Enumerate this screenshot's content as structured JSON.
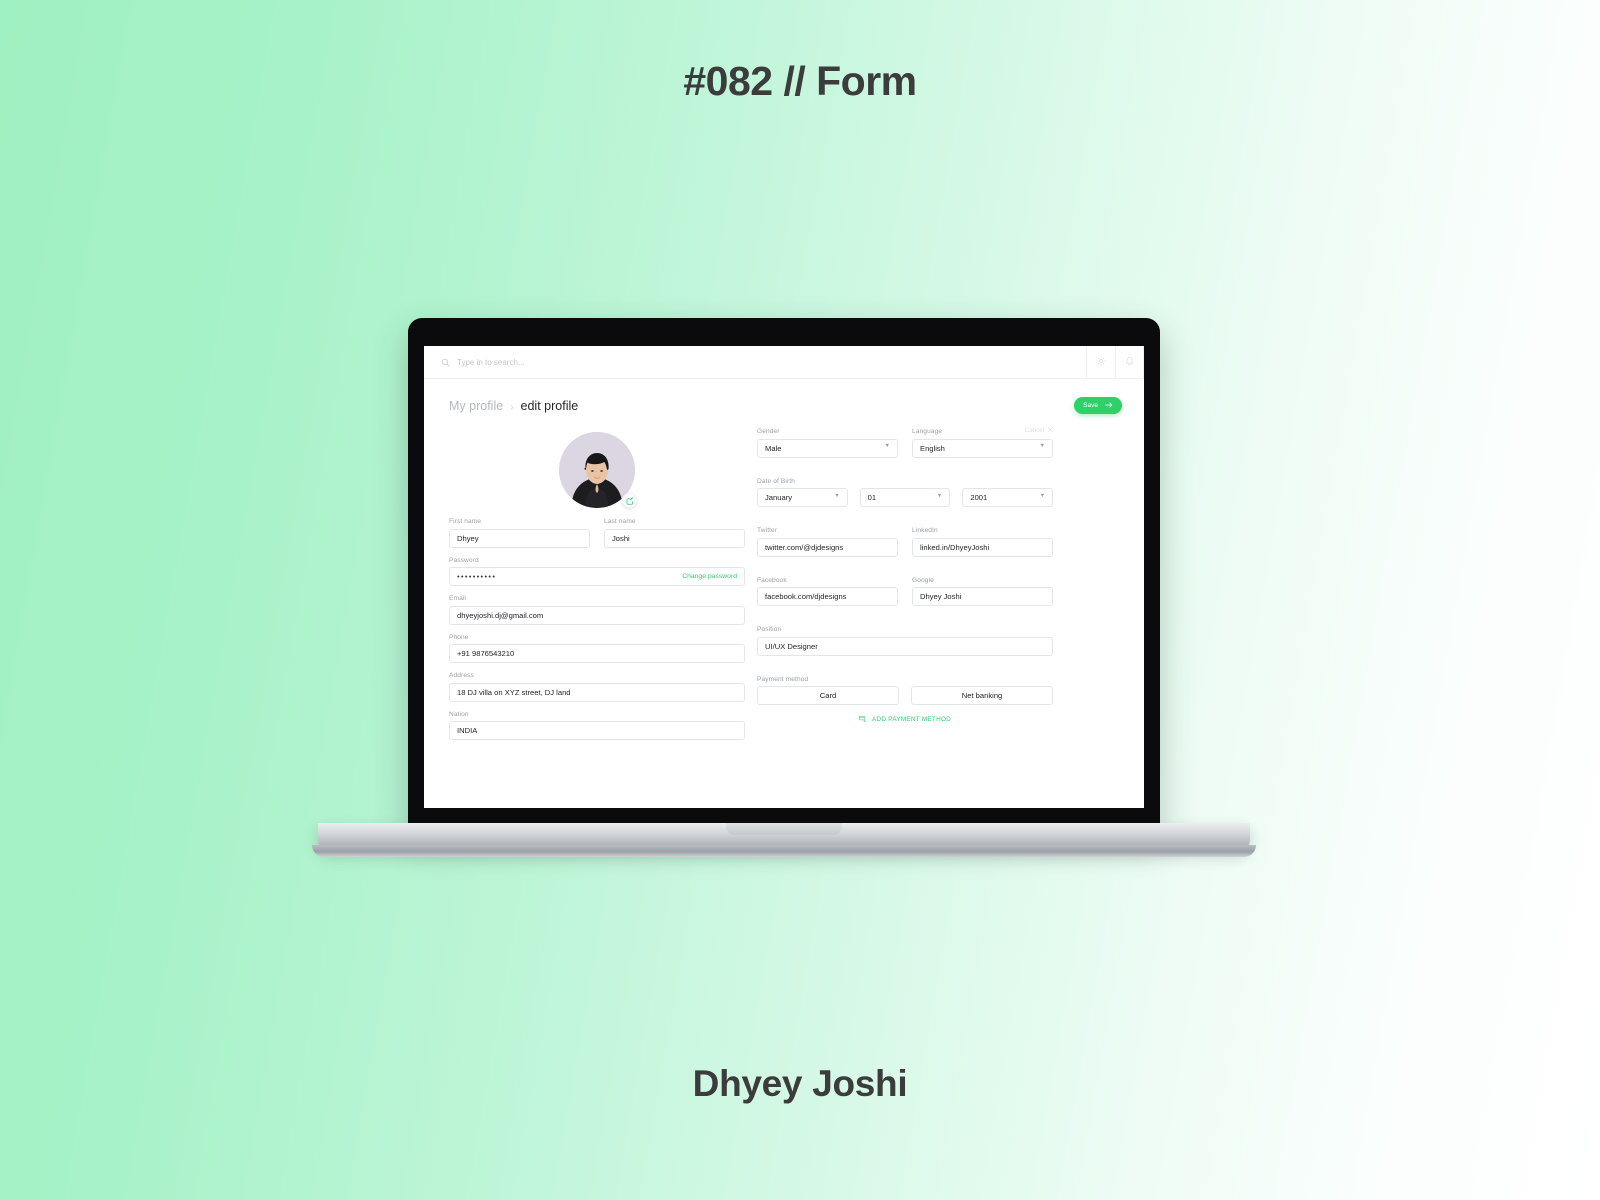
{
  "poster": {
    "title": "#082 // Form",
    "author": "Dhyey Joshi"
  },
  "app": {
    "search": {
      "placeholder": "Type in to search...",
      "value": "",
      "icon": "search-icon"
    },
    "topbar_actions": [
      {
        "name": "settings-icon",
        "label": "Settings"
      },
      {
        "name": "bell-icon",
        "label": "Notifications"
      }
    ],
    "breadcrumb": {
      "parent": "My profile",
      "separator": "›",
      "current": "edit profile"
    },
    "save_button": {
      "label": "Save",
      "icon": "arrow-right-icon",
      "color": "#2ED06A"
    },
    "cancel_link": {
      "label": "Cancel",
      "icon": "close-icon"
    },
    "avatar": {
      "edit_icon": "edit-pencil-icon",
      "alt": "profile-photo"
    },
    "form": {
      "first_name": {
        "label": "First name",
        "value": "Dhyey"
      },
      "last_name": {
        "label": "Last name",
        "value": "Joshi"
      },
      "password": {
        "label": "Password",
        "value": "••••••••••",
        "action": "Change password"
      },
      "email": {
        "label": "Email",
        "value": "dhyeyjoshi.dj@gmail.com"
      },
      "phone": {
        "label": "Phone",
        "value": "+91 9876543210"
      },
      "address": {
        "label": "Address",
        "value": "18 DJ villa on XYZ street, DJ land"
      },
      "nation": {
        "label": "Nation",
        "value": "INDIA"
      },
      "gender": {
        "label": "Gender",
        "value": "Male"
      },
      "language": {
        "label": "Language",
        "value": "English"
      },
      "dob": {
        "label": "Date of Birth",
        "month": "January",
        "day": "01",
        "year": "2001"
      },
      "twitter": {
        "label": "Twitter",
        "value": "twitter.com/@djdesigns"
      },
      "linkedin": {
        "label": "LinkedIn",
        "value": "linked.in/DhyeyJoshi"
      },
      "facebook": {
        "label": "Facebook",
        "value": "facebook.com/djdesigns"
      },
      "google": {
        "label": "Google",
        "value": "Dhyey Joshi"
      },
      "position": {
        "label": "Position",
        "value": "UI/UX Designer"
      },
      "payment": {
        "label": "Payment method",
        "options": [
          "Card",
          "Net banking"
        ],
        "add_label": "ADD PAYMENT METHOD",
        "add_icon": "add-card-icon"
      }
    }
  }
}
